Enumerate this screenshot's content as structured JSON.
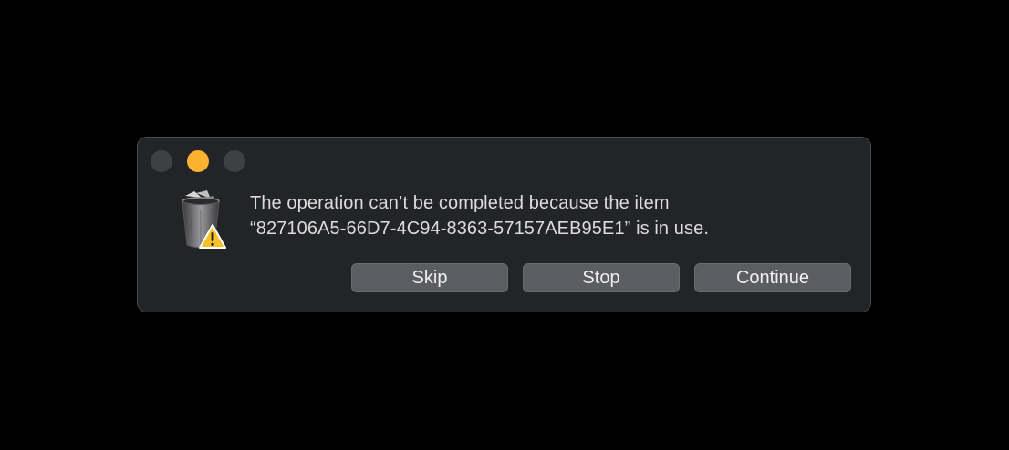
{
  "window": {
    "controls": [
      {
        "name": "close",
        "color": "#3f4043"
      },
      {
        "name": "minimize",
        "color": "#fbb32f"
      },
      {
        "name": "zoom",
        "color": "#3f4043"
      }
    ]
  },
  "alert": {
    "icon": "trash-with-warning-icon",
    "message_line1": "The operation can’t be completed because the item",
    "message_line2": "“827106A5-66D7-4C94-8363-57157AEB95E1” is in use."
  },
  "buttons": {
    "skip": "Skip",
    "stop": "Stop",
    "continue": "Continue"
  },
  "colors": {
    "background": "#000000",
    "dialog": "#232427",
    "button": "#5b5d62",
    "text": "#dcdcdc"
  }
}
